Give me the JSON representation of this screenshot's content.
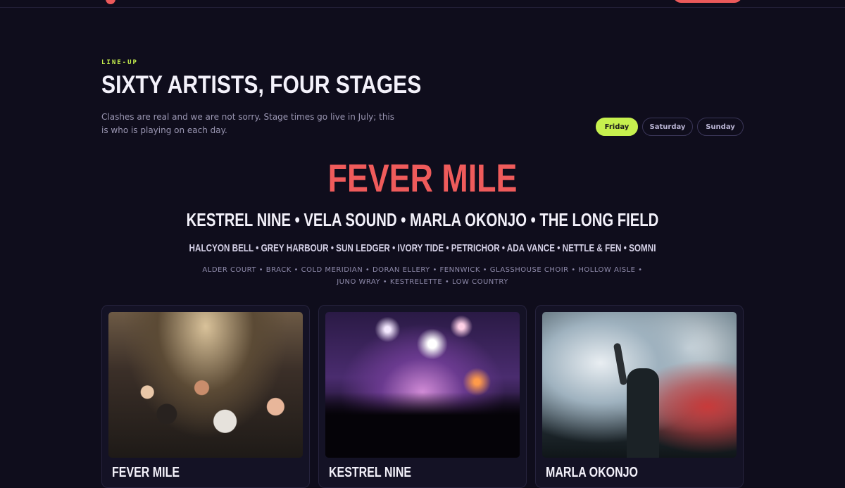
{
  "lineup": {
    "eyebrow": "LINE-UP",
    "title": "SIXTY ARTISTS, FOUR STAGES",
    "lede": "Clashes are real and we are not sorry. Stage times go live in July; this is who is playing on each day."
  },
  "day_tabs": [
    {
      "label": "Friday",
      "active": true
    },
    {
      "label": "Saturday",
      "active": false
    },
    {
      "label": "Sunday",
      "active": false
    }
  ],
  "poster": {
    "headliner": "FEVER MILE",
    "tier2": "KESTREL NINE • VELA SOUND • MARLA OKONJO • THE LONG FIELD",
    "tier3": "HALCYON BELL • GREY HARBOUR • SUN LEDGER • IVORY TIDE • PETRICHOR • ADA VANCE • NETTLE & FEN • SOMNI",
    "tier4": "ALDER COURT • BRACK • COLD MERIDIAN • DORAN ELLERY • FENNWICK • GLASSHOUSE CHOIR • HOLLOW AISLE • JUNO WRAY • KESTRELETTE • LOW COUNTRY"
  },
  "cards": [
    {
      "title": "FEVER MILE"
    },
    {
      "title": "KESTREL NINE"
    },
    {
      "title": "MARLA OKONJO"
    }
  ],
  "colors": {
    "background": "#0f0d1c",
    "accent_lime": "#c6f04e",
    "accent_red": "#ef5b5b"
  }
}
